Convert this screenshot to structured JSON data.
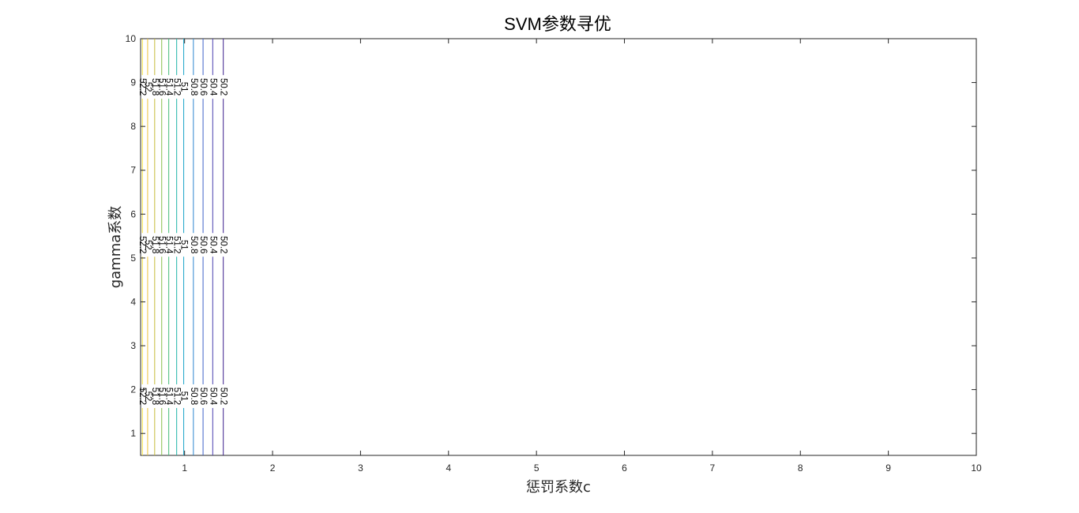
{
  "chart_data": {
    "type": "contour",
    "title": "SVM参数寻优",
    "xlabel": "惩罚系数c",
    "ylabel": "gamma系数",
    "xlim": [
      0.5,
      10
    ],
    "ylim": [
      0.5,
      10
    ],
    "xticks": [
      1,
      2,
      3,
      4,
      5,
      6,
      7,
      8,
      9,
      10
    ],
    "yticks": [
      1,
      2,
      3,
      4,
      5,
      6,
      7,
      8,
      9,
      10
    ],
    "grid": false,
    "box": true,
    "contours": [
      {
        "x": 1.44,
        "level": "50.2",
        "color": "#3b1f8c"
      },
      {
        "x": 1.32,
        "level": "50.4",
        "color": "#4a3fb0"
      },
      {
        "x": 1.21,
        "level": "50.6",
        "color": "#3d61c8"
      },
      {
        "x": 1.1,
        "level": "50.8",
        "color": "#2c86d0"
      },
      {
        "x": 0.99,
        "level": "51",
        "color": "#1aa3c9"
      },
      {
        "x": 0.91,
        "level": "51.2",
        "color": "#21b4a8"
      },
      {
        "x": 0.82,
        "level": "51.4",
        "color": "#45bc7a"
      },
      {
        "x": 0.74,
        "level": "51.6",
        "color": "#8abf4e"
      },
      {
        "x": 0.66,
        "level": "51.8",
        "color": "#c5bb38"
      },
      {
        "x": 0.58,
        "level": "52",
        "color": "#f0c43a"
      },
      {
        "x": 0.52,
        "level": "52.2",
        "color": "#f8e23a"
      }
    ],
    "label_y": [
      8.9,
      5.3,
      1.85
    ]
  }
}
